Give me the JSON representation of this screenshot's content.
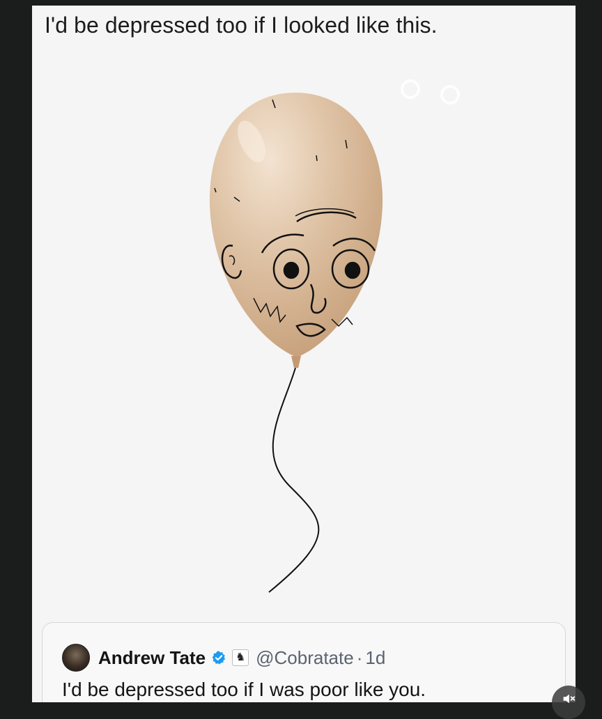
{
  "post": {
    "caption": "I'd be depressed too if I looked like this."
  },
  "quoted_tweet": {
    "display_name": "Andrew Tate",
    "verified_icon": "verified-check-icon",
    "badge_icon": "chess-knight-icon",
    "badge_glyph": "♞",
    "handle": "@Cobratate",
    "separator": "·",
    "time_ago": "1d",
    "text": "I'd be depressed too if I was poor like you."
  },
  "controls": {
    "mute_icon": "speaker-muted-icon"
  },
  "colors": {
    "background": "#1a1d1c",
    "frame": "#f5f5f5",
    "balloon": "#dfc3a6",
    "verified_blue": "#1d9bf0"
  }
}
